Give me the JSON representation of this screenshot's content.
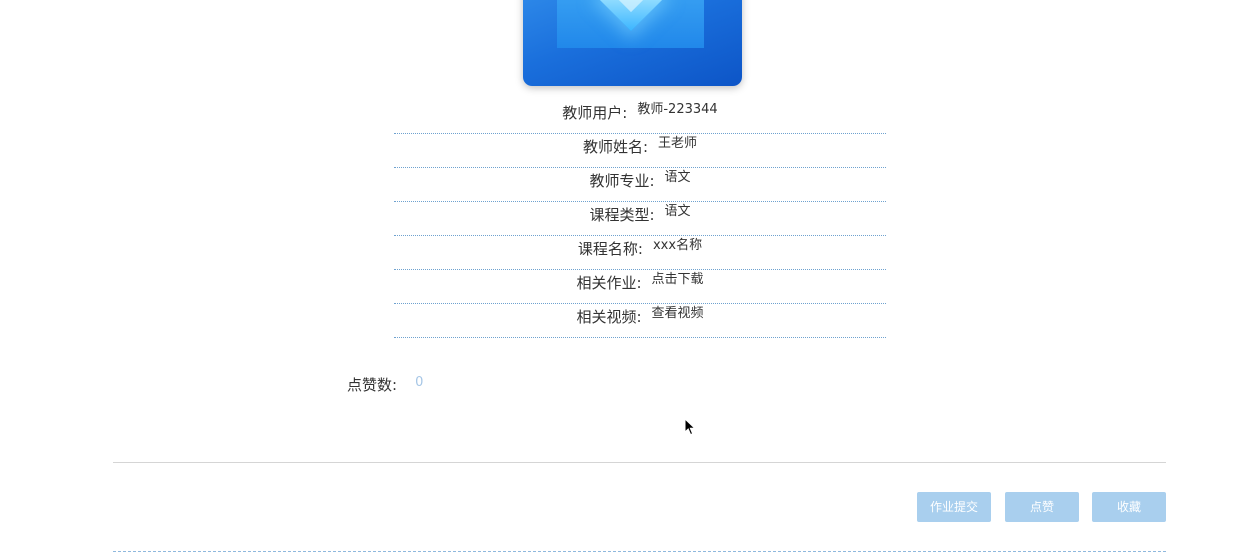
{
  "details": {
    "teacher_user": {
      "label": "教师用户:",
      "value": "教师-223344"
    },
    "teacher_name": {
      "label": "教师姓名:",
      "value": "王老师"
    },
    "teacher_major": {
      "label": "教师专业:",
      "value": "语文"
    },
    "course_type": {
      "label": "课程类型:",
      "value": "语文"
    },
    "course_name": {
      "label": "课程名称:",
      "value": "xxx名称"
    },
    "homework": {
      "label": "相关作业:",
      "value": "点击下载"
    },
    "video": {
      "label": "相关视频:",
      "value": "查看视频"
    }
  },
  "likes": {
    "label": "点赞数:",
    "value": "0"
  },
  "actions": {
    "submit_label": "作业提交",
    "like_label": "点赞",
    "favorite_label": "收藏"
  },
  "colors": {
    "accent_button": "#a9cfee",
    "divider_dotted": "#6fa2cf",
    "like_count": "#a6c6e6",
    "cover_blue": "#1a6fdc"
  },
  "icons": {
    "cursor": "mouse-pointer-icon"
  }
}
